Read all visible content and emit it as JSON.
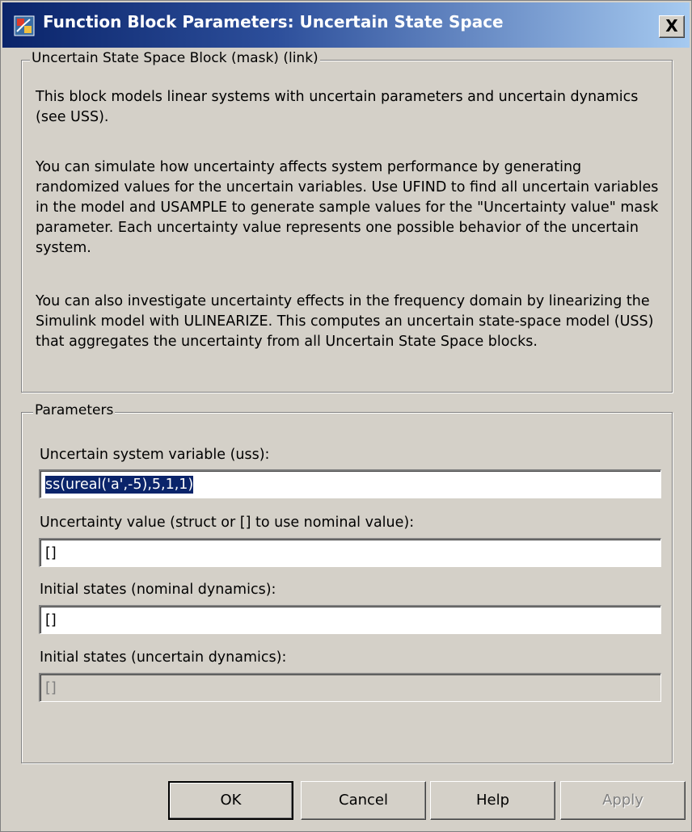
{
  "window": {
    "title": "Function Block Parameters: Uncertain State Space",
    "close_label": "X"
  },
  "description": {
    "legend": "Uncertain State Space Block (mask) (link)",
    "paragraphs": [
      "This block models linear systems with uncertain parameters and uncertain dynamics (see USS).",
      "You can simulate how uncertainty affects system performance by generating randomized values for the uncertain variables. Use UFIND to find all uncertain variables in the model and USAMPLE to generate sample values for the \"Uncertainty value\" mask parameter. Each uncertainty value represents one possible behavior of the uncertain system.",
      "You can also investigate uncertainty effects in the frequency domain by linearizing the Simulink model with ULINEARIZE. This computes an uncertain state-space model (USS) that aggregates the uncertainty from all Uncertain State Space blocks."
    ]
  },
  "parameters": {
    "legend": "Parameters",
    "fields": [
      {
        "label": "Uncertain system variable (uss):",
        "value": "ss(ureal('a',-5),5,1,1)",
        "selected": true,
        "enabled": true
      },
      {
        "label": "Uncertainty value (struct or [] to use nominal value):",
        "value": "[]",
        "selected": false,
        "enabled": true
      },
      {
        "label": "Initial states (nominal dynamics):",
        "value": "[]",
        "selected": false,
        "enabled": true
      },
      {
        "label": "Initial states (uncertain dynamics):",
        "value": "[]",
        "selected": false,
        "enabled": false
      }
    ]
  },
  "buttons": {
    "ok": "OK",
    "cancel": "Cancel",
    "help": "Help",
    "apply": "Apply"
  },
  "colors": {
    "titlebar_start": "#0a246a",
    "titlebar_end": "#a6caf0",
    "dialog_bg": "#d4d0c8",
    "selection_bg": "#0a246a"
  }
}
